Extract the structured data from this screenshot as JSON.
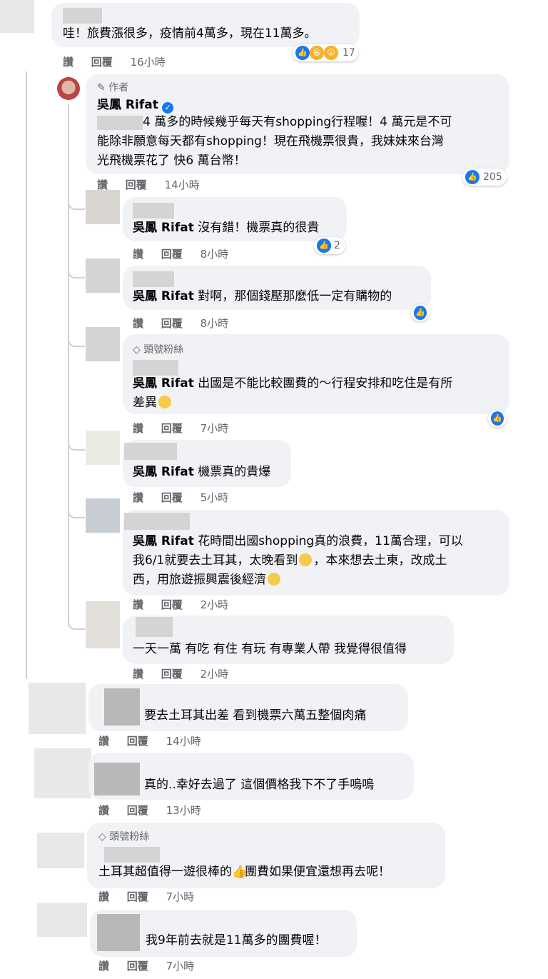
{
  "labels": {
    "like": "讚",
    "reply": "回覆",
    "author": "作者",
    "top_fan": "頭號粉絲"
  },
  "comments": [
    {
      "text": "哇！旅費漲很多，疫情前4萬多，現在11萬多。",
      "time": "16小時",
      "reactions": "17"
    },
    {
      "name": "吳鳳 Rifat",
      "lines": [
        "4 萬多的時候幾乎每天有shopping行程喔！4 萬元是不可",
        "能除非願意每天都有shopping！現在飛機票很貴，我妹妹來台灣",
        "光飛機票花了 快6 萬台幣！"
      ],
      "time": "14小時",
      "reactions": "205"
    },
    {
      "name": "吳鳳 Rifat",
      "text": "沒有錯！機票真的很貴",
      "time": "8小時",
      "reactions": "2"
    },
    {
      "name": "吳鳳 Rifat",
      "text": "對啊，那個錢壓那麼低一定有購物的",
      "time": "8小時"
    },
    {
      "name": "吳鳳 Rifat",
      "lines": [
        "出國是不能比較團費的～行程安排和吃住是有所",
        "差異"
      ],
      "time": "7小時"
    },
    {
      "name": "吳鳳 Rifat",
      "text": "機票真的貴爆",
      "time": "5小時"
    },
    {
      "name": "吳鳳 Rifat",
      "lines": [
        "花時間出國shopping真的浪費，11萬合理，可以",
        "我6/1就要去土耳其，太晚看到",
        "，本來想去土東，改成土",
        "西，用旅遊振興震後經濟"
      ],
      "time": "2小時"
    },
    {
      "text": "一天一萬 有吃 有住 有玩 有專業人帶 我覺得很值得",
      "time": "2小時"
    },
    {
      "text": "要去土耳其出差 看到機票六萬五整個肉痛",
      "time": "14小時"
    },
    {
      "text": "真的..幸好去過了 這個價格我下不了手嗚嗚",
      "time": "13小時"
    },
    {
      "lines": [
        "土耳其超值得一遊很棒的",
        "團費如果便宜還想再去呢！"
      ],
      "time": "7小時"
    },
    {
      "text": "我9年前去就是11萬多的團費喔！",
      "time": "7小時"
    }
  ]
}
